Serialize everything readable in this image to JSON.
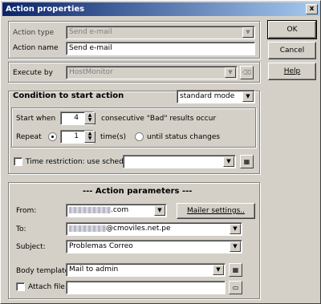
{
  "window": {
    "title": "Action properties",
    "close_glyph": "x"
  },
  "buttons": {
    "ok": "OK",
    "cancel": "Cancel",
    "help": "Help"
  },
  "action": {
    "type_label": "Action type",
    "type_value": "Send e-mail",
    "name_label": "Action name",
    "name_value": "Send e-mail"
  },
  "execute": {
    "label": "Execute by",
    "value": "HostMonitor"
  },
  "condition": {
    "title": "Condition to start action",
    "mode_value": "standard mode",
    "start_when_label": "Start when",
    "start_when_value": "4",
    "start_when_suffix": "consecutive \"Bad\" results occur",
    "repeat_label": "Repeat",
    "repeat_value": "1",
    "repeat_suffix": "time(s)",
    "until_label": "until status changes",
    "time_restriction_label": "Time restriction: use schedule",
    "schedule_value": ""
  },
  "params": {
    "title": "---   Action parameters   ---",
    "from_label": "From:",
    "from_suffix": ".com",
    "mailer_button": "Mailer settings..",
    "to_label": "To:",
    "to_suffix": "@cmoviles.net.pe",
    "subject_label": "Subject:",
    "subject_value": "Problemas Correo",
    "body_label": "Body template",
    "body_value": "Mail to admin",
    "attach_label": "Attach file",
    "attach_value": ""
  },
  "icons": {
    "dropdown": "dropdown-arrow-icon",
    "spin": "spin-icon",
    "schedule": "schedule-icon",
    "eraser": "eraser-icon",
    "folder": "folder-open-icon"
  }
}
